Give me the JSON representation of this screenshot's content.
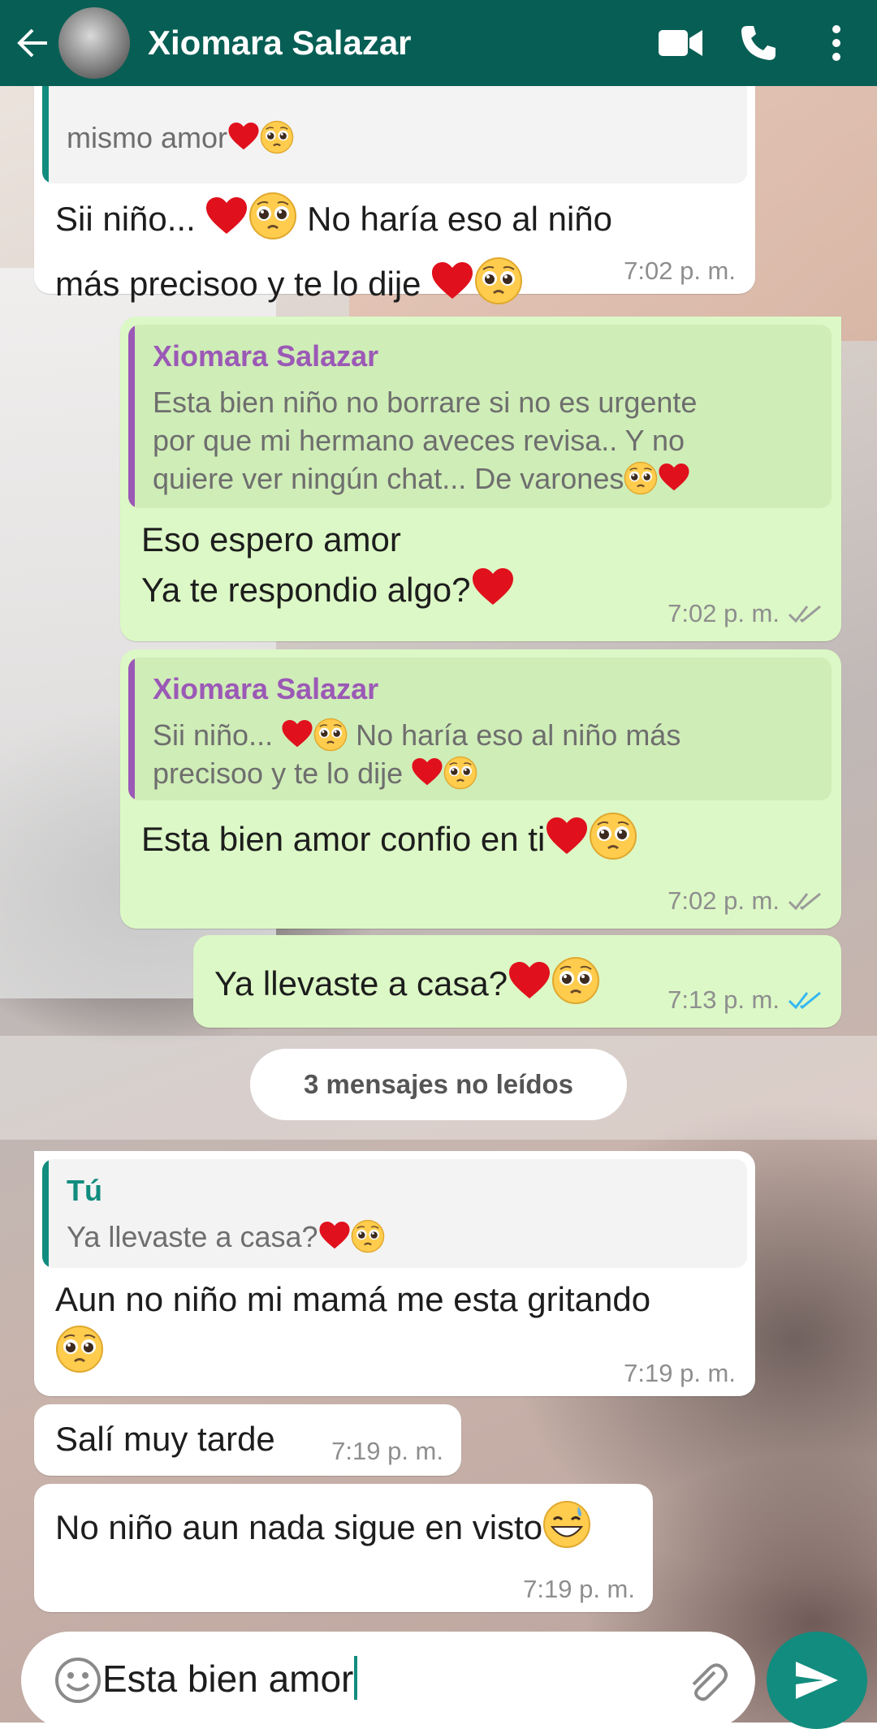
{
  "header": {
    "contact_name": "Xiomara Salazar",
    "icons": [
      "back-arrow-icon",
      "video-call-icon",
      "phone-icon",
      "more-vert-icon"
    ]
  },
  "colors": {
    "header": "#075e54",
    "outgoing": "#dcf8c6",
    "incoming": "#ffffff",
    "accent": "#128c7e",
    "quote_name_out": "#9b59b6",
    "quote_name_in": "#128c7e",
    "read_ticks": "#34b7f1"
  },
  "messages": [
    {
      "direction": "in",
      "quote_text": "mismo amor",
      "text_line1": "Sii niño...",
      "text_line1b": "No haría eso al niño",
      "text_line2": "más precisoo y te lo dije",
      "time": "7:02 p. m."
    },
    {
      "direction": "out",
      "quote_name": "Xiomara Salazar",
      "quote_line1": "Esta bien niño no borrare si no  es urgente",
      "quote_line2": "por que mi hermano aveces revisa.. Y no",
      "quote_line3": "quiere ver ningún chat... De varones",
      "text_line1": "Eso espero amor",
      "text_line2": "Ya te respondio algo?",
      "time": "7:02 p. m."
    },
    {
      "direction": "out",
      "quote_name": "Xiomara Salazar",
      "quote_line1": "Sii niño...",
      "quote_line1b": "No haría eso al niño más",
      "quote_line2": "precisoo y te lo dije",
      "text": "Esta bien amor confio en ti",
      "time": "7:02 p. m."
    },
    {
      "direction": "out",
      "text": "Ya llevaste a casa?",
      "time": "7:13 p. m."
    },
    {
      "direction": "in",
      "quote_name": "Tú",
      "quote_text": "Ya llevaste a casa?",
      "text": "Aun no niño mi mamá me esta gritando",
      "time": "7:19 p. m."
    },
    {
      "direction": "in",
      "text": "Salí muy tarde",
      "time": "7:19 p. m."
    },
    {
      "direction": "in",
      "text": "No niño aun nada sigue en visto",
      "time": "7:19 p. m."
    }
  ],
  "unread_banner": "3 mensajes no leídos",
  "composer": {
    "value": "Esta bien amor",
    "icons": [
      "emoji-icon",
      "attach-icon",
      "send-icon"
    ]
  }
}
